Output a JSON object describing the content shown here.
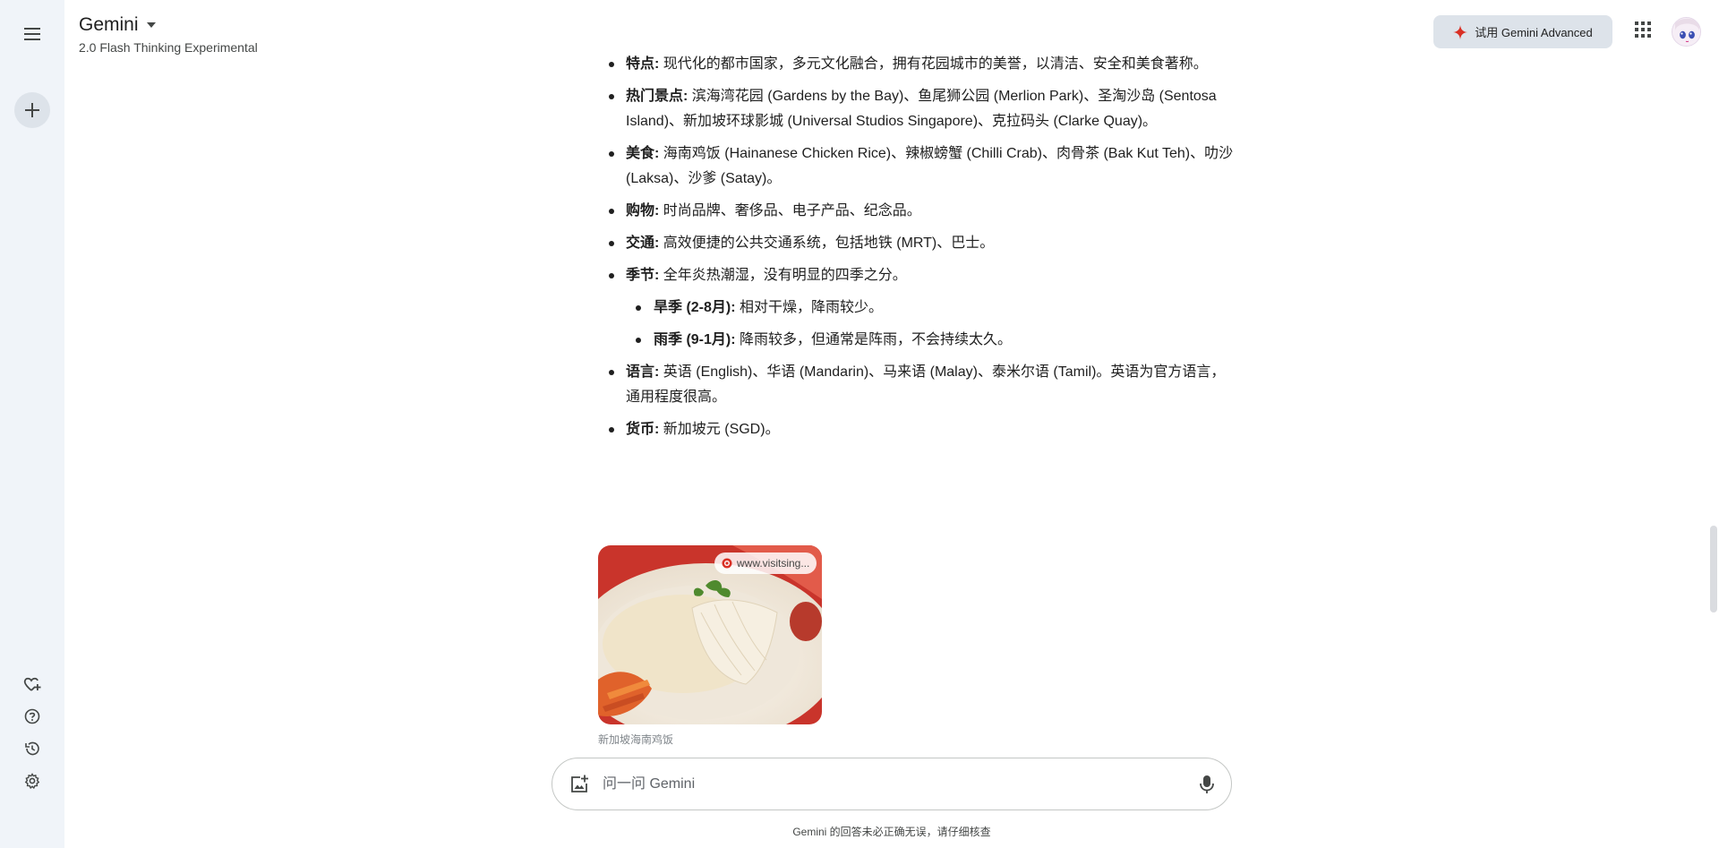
{
  "header": {
    "app_title": "Gemini",
    "model_name": "2.0 Flash Thinking Experimental",
    "advanced_button": "试用 Gemini Advanced"
  },
  "content": {
    "items": [
      {
        "label": "特点:",
        "text": " 现代化的都市国家，多元文化融合，拥有花园城市的美誉，以清洁、安全和美食著称。"
      },
      {
        "label": "热门景点:",
        "text": " 滨海湾花园 (Gardens by the Bay)、鱼尾狮公园 (Merlion Park)、圣淘沙岛 (Sentosa Island)、新加坡环球影城 (Universal Studios Singapore)、克拉码头 (Clarke Quay)。"
      },
      {
        "label": "美食:",
        "text": " 海南鸡饭 (Hainanese Chicken Rice)、辣椒螃蟹 (Chilli Crab)、肉骨茶 (Bak Kut Teh)、叻沙 (Laksa)、沙爹 (Satay)。"
      },
      {
        "label": "购物:",
        "text": " 时尚品牌、奢侈品、电子产品、纪念品。"
      },
      {
        "label": "交通:",
        "text": " 高效便捷的公共交通系统，包括地铁 (MRT)、巴士。"
      },
      {
        "label": "季节:",
        "text": " 全年炎热潮湿，没有明显的四季之分。"
      },
      {
        "label": "旱季 (2-8月):",
        "text": " 相对干燥，降雨较少。"
      },
      {
        "label": "雨季 (9-1月):",
        "text": " 降雨较多，但通常是阵雨，不会持续太久。"
      },
      {
        "label": "语言:",
        "text": " 英语 (English)、华语 (Mandarin)、马来语 (Malay)、泰米尔语 (Tamil)。英语为官方语言，通用程度很高。"
      },
      {
        "label": "货币:",
        "text": " 新加坡元 (SGD)。"
      }
    ]
  },
  "image": {
    "source": "www.visitsing...",
    "caption": "新加坡海南鸡饭"
  },
  "input": {
    "placeholder": "问一问 Gemini"
  },
  "disclaimer": "Gemini 的回答未必正确无误，请仔细核查",
  "icons": {
    "menu": "menu-icon",
    "new_chat": "plus-icon",
    "gem": "heart-plus-icon",
    "help": "help-icon",
    "activity": "history-icon",
    "settings": "gear-icon",
    "apps": "apps-grid-icon",
    "image_upload": "add-image-icon",
    "mic": "mic-icon"
  },
  "colors": {
    "accent": "#d93025",
    "sidebar_bg": "#f0f4f9",
    "advanced_bg": "#dde3ea"
  }
}
